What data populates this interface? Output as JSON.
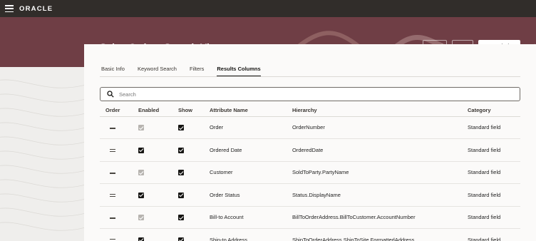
{
  "topbar": {
    "brand": "ORACLE"
  },
  "header": {
    "title": "Sales Orders Search View",
    "cancel_label": "Cancel",
    "save_label": "Save",
    "save_close_label": "Save and Close"
  },
  "tabs": [
    {
      "label": "Basic Info",
      "active": false
    },
    {
      "label": "Keyword Search",
      "active": false
    },
    {
      "label": "Filters",
      "active": false
    },
    {
      "label": "Results Columns",
      "active": true
    }
  ],
  "search": {
    "placeholder": "Search",
    "value": ""
  },
  "table": {
    "columns": [
      "Order",
      "Enabled",
      "Show",
      "Attribute Name",
      "Hierarchy",
      "Category"
    ],
    "rows": [
      {
        "enabled": true,
        "enabled_locked": true,
        "show": true,
        "attribute": "Order",
        "hierarchy": "OrderNumber",
        "category": "Standard field"
      },
      {
        "enabled": true,
        "enabled_locked": false,
        "show": true,
        "attribute": "Ordered Date",
        "hierarchy": "OrderedDate",
        "category": "Standard field"
      },
      {
        "enabled": true,
        "enabled_locked": true,
        "show": true,
        "attribute": "Customer",
        "hierarchy": "SoldToParty.PartyName",
        "category": "Standard field"
      },
      {
        "enabled": true,
        "enabled_locked": false,
        "show": true,
        "attribute": "Order Status",
        "hierarchy": "Status.DisplayName",
        "category": "Standard field"
      },
      {
        "enabled": true,
        "enabled_locked": true,
        "show": true,
        "attribute": "Bill-to Account",
        "hierarchy": "BillToOrderAddress.BillToCustomer.AccountNumber",
        "category": "Standard field"
      },
      {
        "enabled": true,
        "enabled_locked": false,
        "show": true,
        "attribute": "Ship-to Address",
        "hierarchy": "ShipToOrderAddress.ShipToSite.FormattedAddress",
        "category": "Standard field"
      }
    ]
  },
  "colors": {
    "topbar": "#312d2a",
    "banner": "#6f3e45",
    "panel": "#fbfaf9"
  },
  "icons": {
    "menu": "hamburger-icon",
    "search": "search-icon",
    "reorder": "drag-handle-icon",
    "check": "checkbox-checked-icon"
  }
}
